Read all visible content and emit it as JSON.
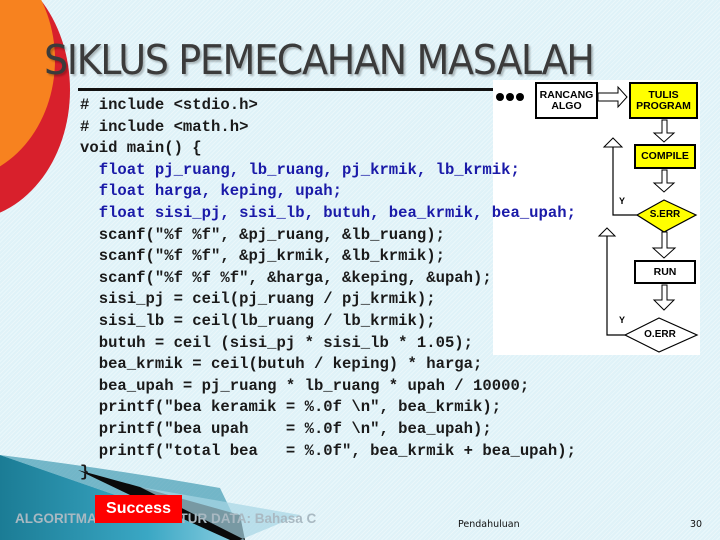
{
  "slide": {
    "title": "SIKLUS PEMECAHAN MASALAH",
    "code_lines": [
      {
        "text": "# include <stdio.h>",
        "color": "#1a1a1a"
      },
      {
        "text": "# include <math.h>",
        "color": "#1a1a1a"
      },
      {
        "text": "void main() {",
        "color": "#1a1a1a"
      },
      {
        "text": "  float pj_ruang, lb_ruang, pj_krmik, lb_krmik;",
        "color": "#1a1aa8"
      },
      {
        "text": "  float harga, keping, upah;",
        "color": "#1a1aa8"
      },
      {
        "text": "  float sisi_pj, sisi_lb, butuh, bea_krmik, bea_upah;",
        "color": "#1a1aa8"
      },
      {
        "text": "  scanf(\"%f %f\", &pj_ruang, &lb_ruang);",
        "color": "#1a1a1a"
      },
      {
        "text": "  scanf(\"%f %f\", &pj_krmik, &lb_krmik);",
        "color": "#1a1a1a"
      },
      {
        "text": "  scanf(\"%f %f %f\", &harga, &keping, &upah);",
        "color": "#1a1a1a"
      },
      {
        "text": "  sisi_pj = ceil(pj_ruang / pj_krmik);",
        "color": "#1a1a1a"
      },
      {
        "text": "  sisi_lb = ceil(lb_ruang / lb_krmik);",
        "color": "#1a1a1a"
      },
      {
        "text": "  butuh = ceil (sisi_pj * sisi_lb * 1.05);",
        "color": "#1a1a1a"
      },
      {
        "text": "  bea_krmik = ceil(butuh / keping) * harga;",
        "color": "#1a1a1a"
      },
      {
        "text": "  bea_upah = pj_ruang * lb_ruang * upah / 10000;",
        "color": "#1a1a1a"
      },
      {
        "text": "  printf(\"bea keramik = %.0f \\n\", bea_krmik);",
        "color": "#1a1a1a"
      },
      {
        "text": "  printf(\"bea upah    = %.0f \\n\", bea_upah);",
        "color": "#1a1a1a"
      },
      {
        "text": "  printf(\"total bea   = %.0f\", bea_krmik + bea_upah);",
        "color": "#1a1a1a"
      },
      {
        "text": "}",
        "color": "#1a1a1a"
      }
    ]
  },
  "flowchart": {
    "rancang": "RANCANG\nALGO",
    "tulis": "TULIS\nPROGRAM",
    "compile": "COMPILE",
    "s_err": "S.ERR",
    "run": "RUN",
    "o_err": "O.ERR",
    "yes_label_1": "Y",
    "yes_label_2": "Y",
    "colors": {
      "process_highlight": "#ffff00",
      "process_plain": "#ffffff"
    }
  },
  "footer": {
    "course": "ALGORITMA DAN STRUKTUR DATA: Bahasa C",
    "badge": "Success",
    "section": "Pendahuluan",
    "page_number": "30"
  }
}
